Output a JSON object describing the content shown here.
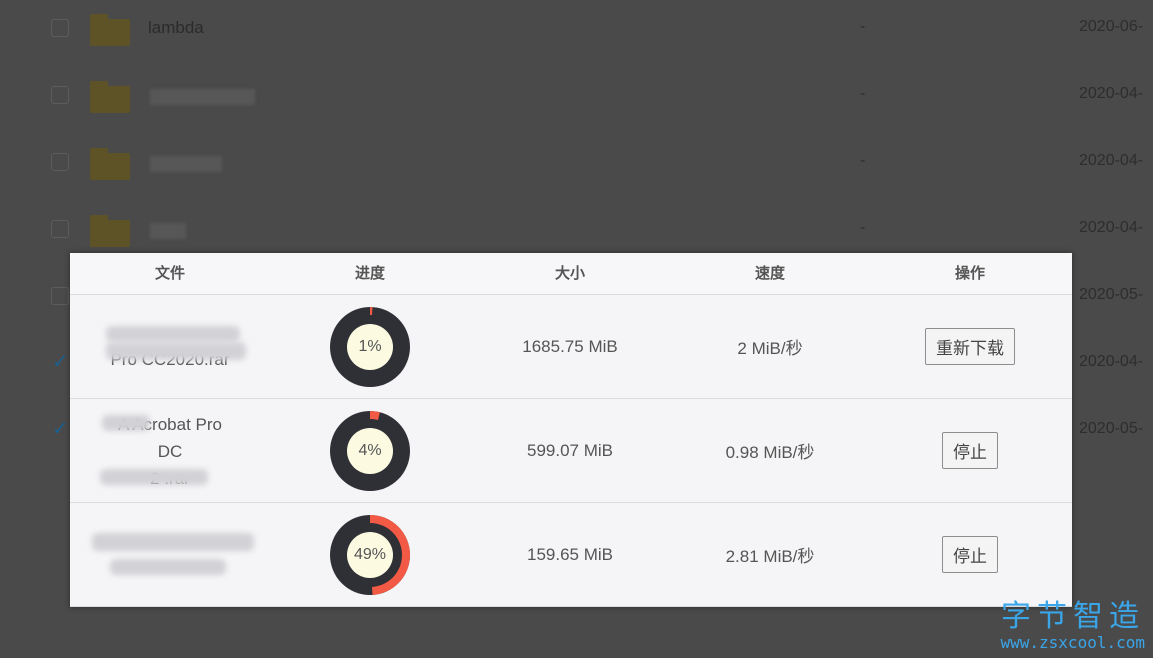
{
  "background_list": {
    "rows": [
      {
        "name": "lambda",
        "size": "-",
        "date": "2020-06-",
        "checked": false
      },
      {
        "name": "",
        "size": "-",
        "date": "2020-04-",
        "checked": false
      },
      {
        "name": "",
        "size": "-",
        "date": "2020-04-",
        "checked": false
      },
      {
        "name": "",
        "size": "-",
        "date": "2020-04-",
        "checked": false
      },
      {
        "name": "",
        "size": "",
        "date": "2020-05-",
        "checked": false
      },
      {
        "name": "",
        "size": "",
        "date": "2020-04-",
        "checked": true
      },
      {
        "name": "",
        "size": "",
        "date": "2020-05-",
        "checked": true
      }
    ]
  },
  "downloads": {
    "headers": {
      "file": "文件",
      "progress": "进度",
      "size": "大小",
      "speed": "速度",
      "action": "操作"
    },
    "rows": [
      {
        "file_line_1": "",
        "file_line_2": "Pro CC2020.rar",
        "progress": 0.01,
        "progress_label": "1%",
        "size": "1685.75 MiB",
        "speed": "2 MiB/秒",
        "action": "重新下载"
      },
      {
        "file_line_1": "A      Acrobat Pro",
        "file_line_2": "DC",
        "file_line_3": "2            .rar",
        "progress": 0.04,
        "progress_label": "4%",
        "size": "599.07 MiB",
        "speed": "0.98 MiB/秒",
        "action": "停止"
      },
      {
        "file_line_1": "",
        "file_line_2": "",
        "progress": 0.49,
        "progress_label": "49%",
        "size": "159.65 MiB",
        "speed": "2.81 MiB/秒",
        "action": "停止"
      }
    ]
  },
  "watermark": {
    "title": "字节智造",
    "url": "www.zsxcool.com"
  },
  "colors": {
    "progress_fill": "#f25a45",
    "progress_track": "#2e3035",
    "progress_center": "#fcfbe2",
    "watermark": "#3aa5e8"
  }
}
